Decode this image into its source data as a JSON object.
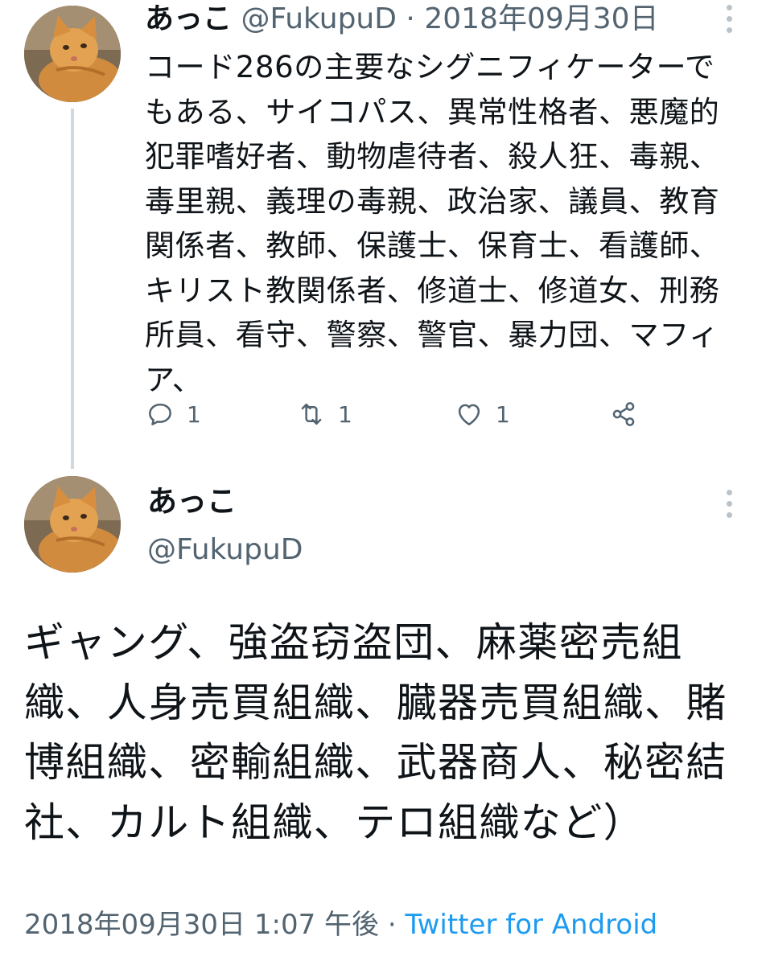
{
  "tweet1": {
    "name": "あっこ",
    "handle": "@FukupuD",
    "separator": "·",
    "date": "2018年09月30日",
    "text": "コード286の主要なシグニフィケーターでもある、サイコパス、異常性格者、悪魔的犯罪嗜好者、動物虐待者、殺人狂、毒親、毒里親、義理の毒親、政治家、議員、教育関係者、教師、保護士、保育士、看護師、キリスト教関係者、修道士、修道女、刑務所員、看守、警察、警官、暴力団、マフィア、",
    "reply_count": "1",
    "retweet_count": "1",
    "like_count": "1"
  },
  "tweet2": {
    "name": "あっこ",
    "handle": "@FukupuD",
    "text": "ギャング、強盗窃盗団、麻薬密売組織、人身売買組織、臓器売買組織、賭博組織、密輸組織、武器商人、秘密結社、カルト組織、テロ組織など）",
    "timestamp": "2018年09月30日 1:07 午後",
    "separator": "·",
    "source": "Twitter for Android"
  },
  "icons": {
    "reply": "reply-icon",
    "retweet": "retweet-icon",
    "like": "heart-icon",
    "share": "share-icon",
    "more": "more-icon"
  },
  "colors": {
    "text": "#0f1419",
    "secondary": "#536471",
    "link": "#1d9bf0",
    "thread_line": "#cfd9de"
  }
}
